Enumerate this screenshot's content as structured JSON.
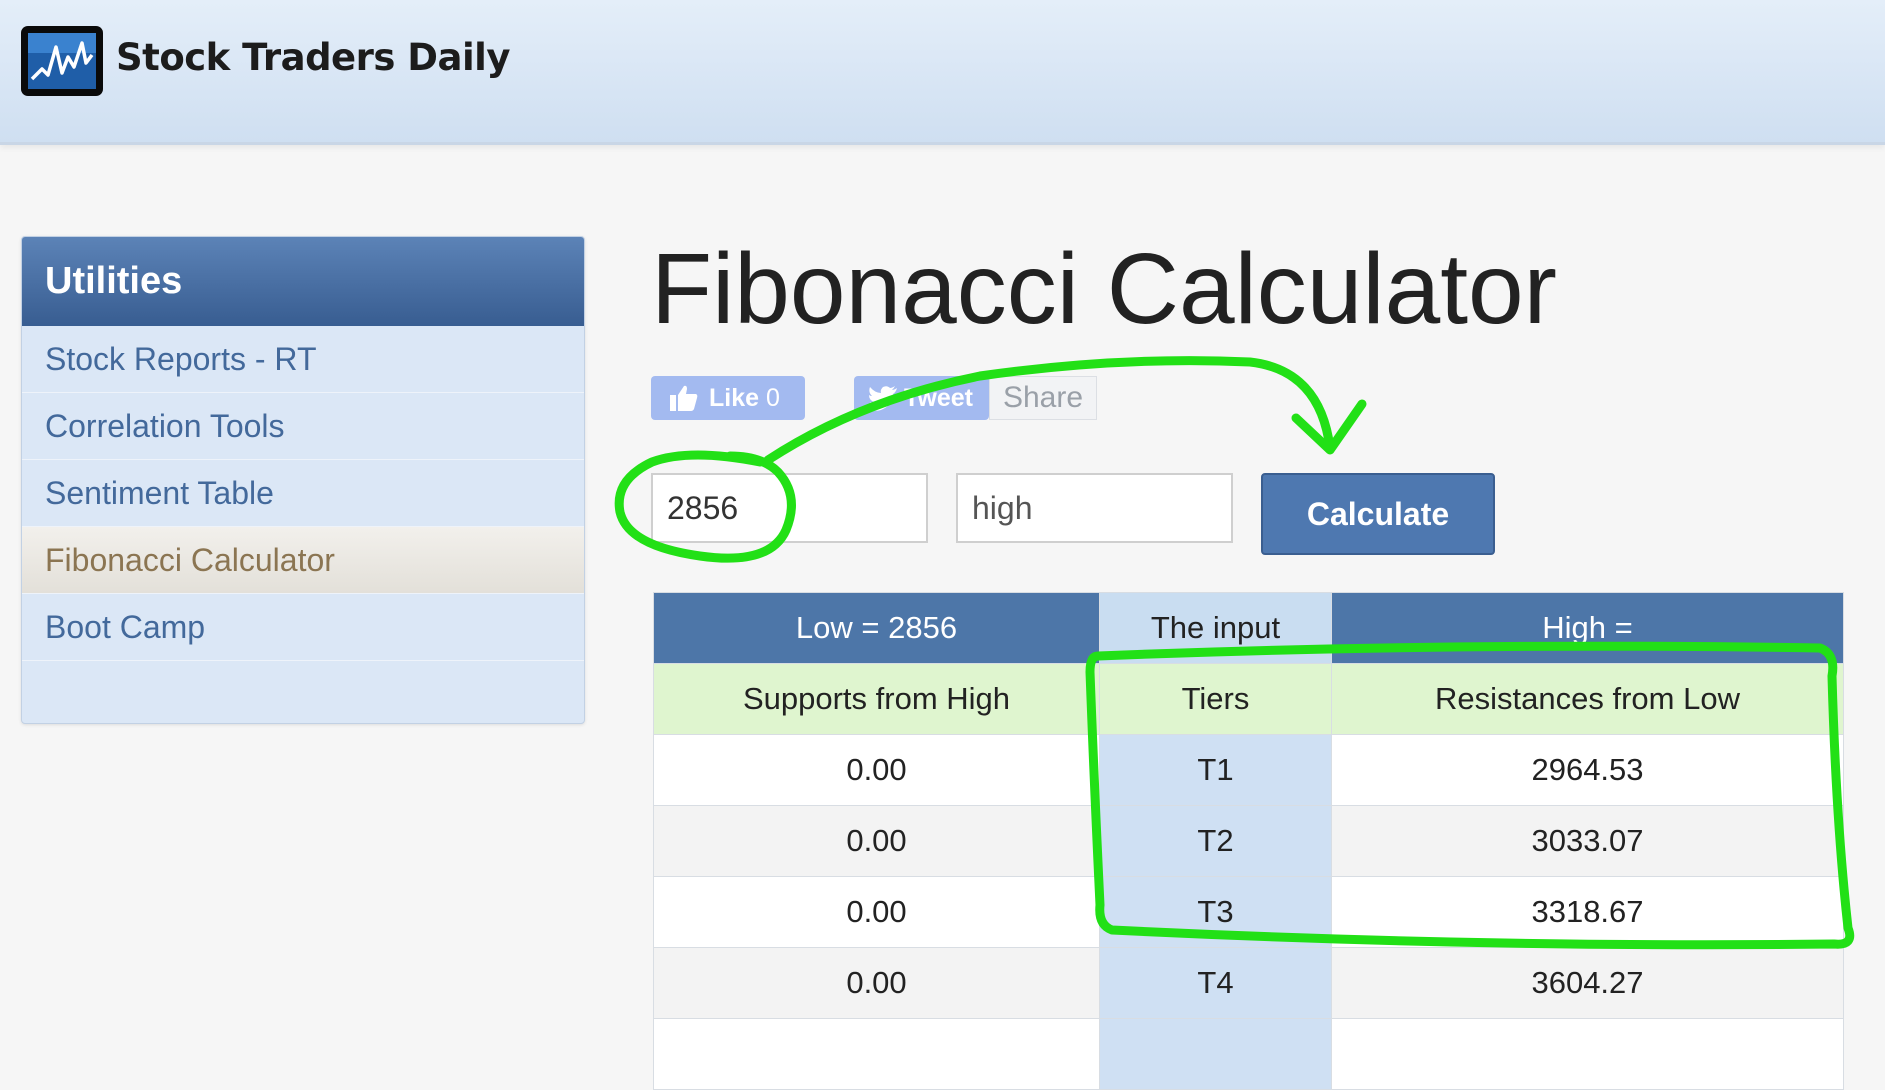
{
  "header": {
    "logo_text": "Stock Traders Daily"
  },
  "sidebar": {
    "title": "Utilities",
    "items": [
      {
        "label": "Stock Reports - RT"
      },
      {
        "label": "Correlation Tools"
      },
      {
        "label": "Sentiment Table"
      },
      {
        "label": "Fibonacci Calculator",
        "active": true
      },
      {
        "label": "Boot Camp"
      }
    ]
  },
  "page": {
    "title": "Fibonacci Calculator"
  },
  "social": {
    "like_label": "Like",
    "like_count": "0",
    "tweet_label": "Tweet",
    "share_label": "Share"
  },
  "form": {
    "low_value": "2856",
    "high_placeholder": "high",
    "calculate_label": "Calculate"
  },
  "table": {
    "header": {
      "low": "Low = 2856",
      "input": "The input",
      "high": "High ="
    },
    "subheader": {
      "supports": "Supports from High",
      "tiers": "Tiers",
      "resistances": "Resistances from Low"
    },
    "rows": [
      {
        "support": "0.00",
        "tier": "T1",
        "resistance": "2964.53"
      },
      {
        "support": "0.00",
        "tier": "T2",
        "resistance": "3033.07"
      },
      {
        "support": "0.00",
        "tier": "T3",
        "resistance": "3318.67"
      },
      {
        "support": "0.00",
        "tier": "T4",
        "resistance": "3604.27"
      }
    ]
  },
  "colors": {
    "annotation": "#22e016",
    "sidebar_header": "#3f6597",
    "table_header": "#4d76a8",
    "subheader_green": "#dff5cf",
    "tier_blue": "#cfe0f3"
  }
}
